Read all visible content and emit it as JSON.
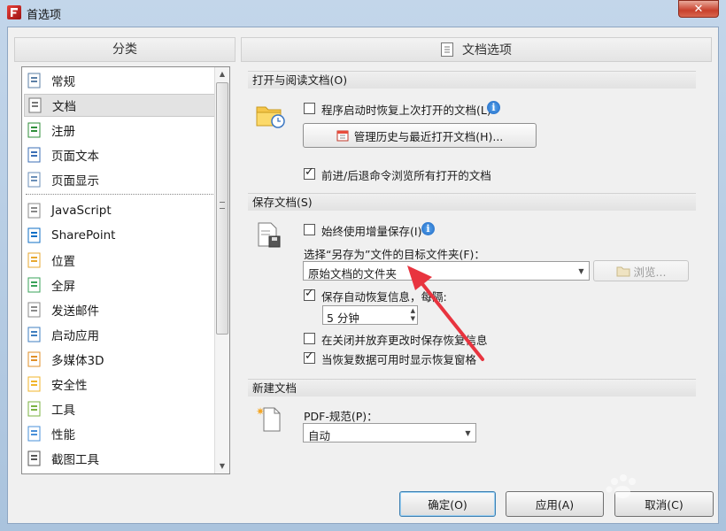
{
  "window": {
    "title": "首选项",
    "close_label": "✕"
  },
  "categories": {
    "header": "分类",
    "items": [
      {
        "label": "常规",
        "icon": "general-settings-icon",
        "selected": false
      },
      {
        "label": "文档",
        "icon": "document-icon",
        "selected": true
      },
      {
        "label": "注册",
        "icon": "user-register-icon",
        "selected": false
      },
      {
        "label": "页面文本",
        "icon": "page-text-icon",
        "selected": false
      },
      {
        "label": "页面显示",
        "icon": "page-display-icon",
        "selected": false
      },
      {
        "label": "JavaScript",
        "icon": "javascript-icon",
        "selected": false
      },
      {
        "label": "SharePoint",
        "icon": "sharepoint-icon",
        "selected": false
      },
      {
        "label": "位置",
        "icon": "folder-location-icon",
        "selected": false
      },
      {
        "label": "全屏",
        "icon": "fullscreen-icon",
        "selected": false
      },
      {
        "label": "发送邮件",
        "icon": "email-icon",
        "selected": false
      },
      {
        "label": "启动应用",
        "icon": "launch-app-icon",
        "selected": false
      },
      {
        "label": "多媒体3D",
        "icon": "multimedia-3d-icon",
        "selected": false
      },
      {
        "label": "安全性",
        "icon": "security-shield-icon",
        "selected": false
      },
      {
        "label": "工具",
        "icon": "tools-icon",
        "selected": false
      },
      {
        "label": "性能",
        "icon": "performance-gauge-icon",
        "selected": false
      },
      {
        "label": "截图工具",
        "icon": "camera-icon",
        "selected": false
      }
    ]
  },
  "document_options": {
    "header": "文档选项",
    "open_group": {
      "title": "打开与阅读文档(O)",
      "restore_label": "程序启动时恢复上次打开的文档(L)",
      "restore_checked": false,
      "manage_history_button": "管理历史与最近打开文档(H)...",
      "nav_label": "前进/后退命令浏览所有打开的文档",
      "nav_checked": true
    },
    "save_group": {
      "title": "保存文档(S)",
      "incremental_label": "始终使用增量保存(I)",
      "incremental_checked": false,
      "target_folder_label": "选择“另存为”文件的目标文件夹(F)：",
      "target_folder_value": "原始文档的文件夹",
      "browse_button": "浏览...",
      "autosave_label": "保存自动恢复信息，每隔:",
      "autosave_checked": true,
      "interval_value": "5 分钟",
      "discard_label": "在关闭并放弃更改时保存恢复信息",
      "discard_checked": false,
      "show_pane_label": "当恢复数据可用时显示恢复窗格",
      "show_pane_checked": true
    },
    "new_group": {
      "title": "新建文档",
      "pdf_spec_label": "PDF-规范(P)：",
      "pdf_spec_value": "自动"
    }
  },
  "dialog_buttons": {
    "ok": "确定(O)",
    "apply": "应用(A)",
    "cancel": "取消(C)"
  },
  "colors": {
    "accent_arrow": "#e8343f",
    "info_blue": "#1d67c3",
    "selection": "#e3e3e3"
  }
}
